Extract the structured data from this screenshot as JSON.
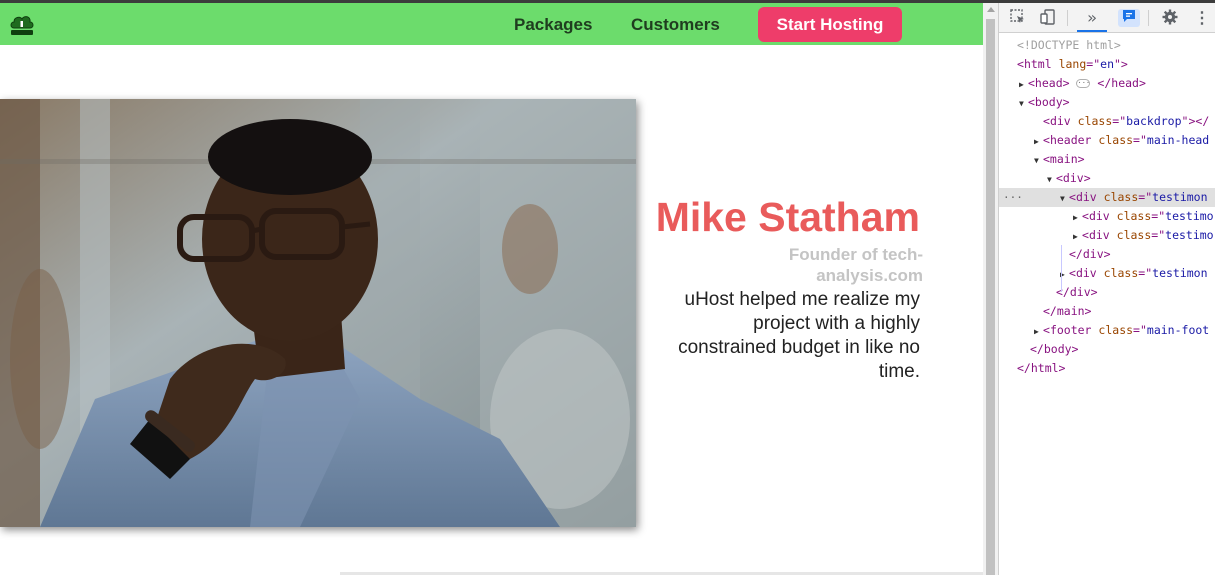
{
  "header": {
    "logo_icon": "uhost-cloud-logo",
    "nav": [
      {
        "label": "Packages"
      },
      {
        "label": "Customers"
      }
    ],
    "cta_label": "Start Hosting"
  },
  "testimonial": {
    "image_alt": "Portrait of a man wearing glasses and a blue denim shirt resting his chin on his hand",
    "name": "Mike Statham",
    "role": "Founder of tech-analysis.com",
    "text": "uHost helped me realize my project with a highly constrained budget in like no time."
  },
  "colors": {
    "header_bg": "#6cdc6c",
    "cta_bg": "#ee3d6a",
    "name_color": "#e95b5b",
    "role_color": "#c4c4c4"
  },
  "devtools": {
    "toolbar_icons": [
      "inspect-icon",
      "device-toolbar-icon",
      "more-tabs-icon",
      "console-messages-icon",
      "settings-icon",
      "kebab-menu-icon"
    ],
    "more_tabs": "»",
    "dom": {
      "doctype": "<!DOCTYPE html>",
      "html_open": {
        "tag": "html",
        "attr": "lang",
        "value": "en"
      },
      "head": {
        "open": "<head>",
        "close": "</head>"
      },
      "body_open": "<body>",
      "backdrop": {
        "tag": "div",
        "attr": "class",
        "value": "backdrop",
        "tail": "></"
      },
      "header": {
        "tag": "header",
        "attr": "class",
        "value": "main-head"
      },
      "main_open": "<main>",
      "div_open": "<div>",
      "testimonial_selected": {
        "tag": "div",
        "attr": "class",
        "value": "testimon"
      },
      "child1": {
        "tag": "div",
        "attr": "class",
        "value": "testimo"
      },
      "child2": {
        "tag": "div",
        "attr": "class",
        "value": "testimo"
      },
      "div_close_inner": "</div>",
      "testimonial2": {
        "tag": "div",
        "attr": "class",
        "value": "testimon"
      },
      "div_close": "</div>",
      "main_close": "</main>",
      "footer": {
        "tag": "footer",
        "attr": "class",
        "value": "main-foot"
      },
      "body_close": "</body>",
      "html_close": "</html>"
    }
  }
}
